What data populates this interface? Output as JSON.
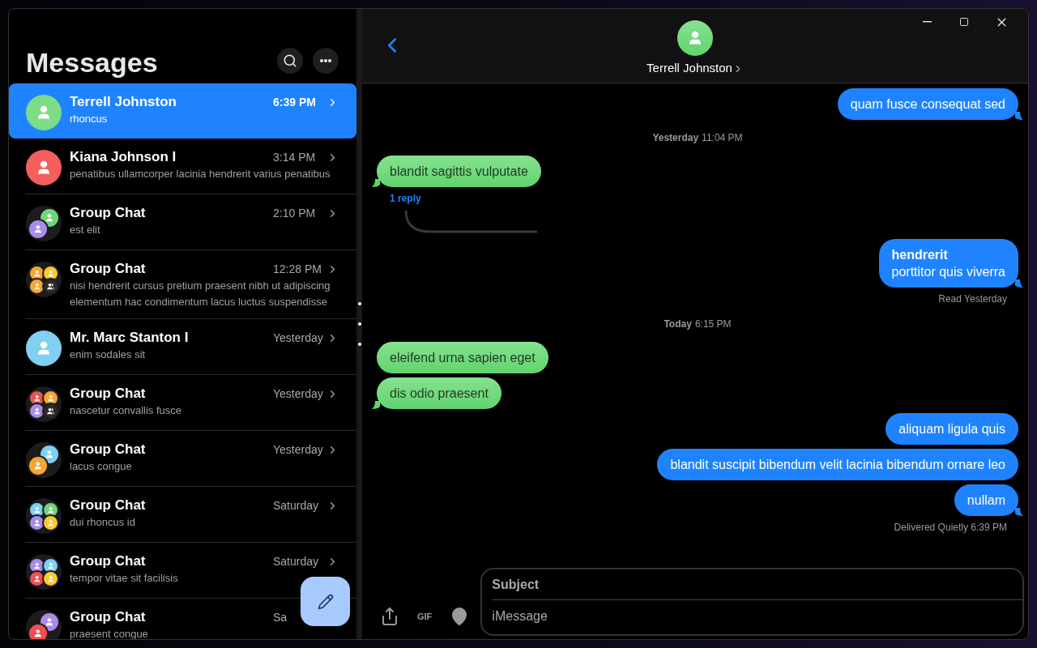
{
  "sidebar": {
    "title": "Messages",
    "conversations": [
      {
        "name": "Terrell Johnston",
        "time": "6:39 PM",
        "preview": "rhoncus",
        "selected": true,
        "avatar": [
          {
            "kind": "person",
            "color": "#7ddc86"
          }
        ]
      },
      {
        "name": "Kiana Johnson I",
        "time": "3:14 PM",
        "preview": "penatibus ullamcorper lacinia hendrerit varius penatibus",
        "selected": false,
        "avatar": [
          {
            "kind": "person",
            "color": "#f25f5c"
          }
        ]
      },
      {
        "name": "Group Chat",
        "time": "2:10 PM",
        "preview": "est elit",
        "selected": false,
        "avatar": [
          {
            "kind": "person",
            "color": "#6fd67a"
          },
          {
            "kind": "person",
            "color": "#a98be8"
          }
        ]
      },
      {
        "name": "Group Chat",
        "time": "12:28 PM",
        "preview": "nisi hendrerit cursus pretium praesent nibh ut adipiscing elementum hac condimentum lacus luctus suspendisse",
        "selected": false,
        "avatar": [
          {
            "kind": "person",
            "color": "#f8a532"
          },
          {
            "kind": "person",
            "color": "#f8c932"
          },
          {
            "kind": "person",
            "color": "#f8a532"
          },
          {
            "kind": "group",
            "color": "#2a2a2a"
          }
        ]
      },
      {
        "name": "Mr. Marc Stanton I",
        "time": "Yesterday",
        "preview": "enim sodales sit",
        "selected": false,
        "avatar": [
          {
            "kind": "person",
            "color": "#7fd0f2"
          }
        ]
      },
      {
        "name": "Group Chat",
        "time": "Yesterday",
        "preview": "nascetur convallis fusce",
        "selected": false,
        "avatar": [
          {
            "kind": "person",
            "color": "#f05050"
          },
          {
            "kind": "person",
            "color": "#f8a532"
          },
          {
            "kind": "person",
            "color": "#a98be8"
          },
          {
            "kind": "group",
            "color": "#2a2a2a"
          }
        ]
      },
      {
        "name": "Group Chat",
        "time": "Yesterday",
        "preview": "lacus congue",
        "selected": false,
        "avatar": [
          {
            "kind": "person",
            "color": "#7fd0f2"
          },
          {
            "kind": "person",
            "color": "#f8a532"
          }
        ]
      },
      {
        "name": "Group Chat",
        "time": "Saturday",
        "preview": "dui rhoncus id",
        "selected": false,
        "avatar": [
          {
            "kind": "person",
            "color": "#7fd0f2"
          },
          {
            "kind": "person",
            "color": "#6fd67a"
          },
          {
            "kind": "person",
            "color": "#a98be8"
          },
          {
            "kind": "person",
            "color": "#f8c932"
          }
        ]
      },
      {
        "name": "Group Chat",
        "time": "Saturday",
        "preview": "tempor vitae sit facilisis",
        "selected": false,
        "avatar": [
          {
            "kind": "person",
            "color": "#a98be8"
          },
          {
            "kind": "person",
            "color": "#7fd0f2"
          },
          {
            "kind": "person",
            "color": "#f05050"
          },
          {
            "kind": "person",
            "color": "#f8c932"
          }
        ]
      },
      {
        "name": "Group Chat",
        "time": "Sa",
        "preview": "praesent congue",
        "selected": false,
        "avatar": [
          {
            "kind": "person",
            "color": "#a98be8"
          },
          {
            "kind": "person",
            "color": "#f05050"
          }
        ]
      }
    ]
  },
  "chat": {
    "contact": "Terrell Johnston",
    "messages": [
      {
        "kind": "sent",
        "text": "quam fusce consequat sed",
        "tail": true
      },
      {
        "kind": "timestamp",
        "day": "Yesterday",
        "time": "11:04 PM"
      },
      {
        "kind": "received",
        "text": "blandit sagittis vulputate",
        "tail": true
      },
      {
        "kind": "reply_link",
        "text": "1 reply"
      },
      {
        "kind": "sent",
        "text": "**hendrerit**\nporttitor quis viverra",
        "tail": true
      },
      {
        "kind": "status",
        "text": "Read Yesterday"
      },
      {
        "kind": "timestamp",
        "day": "Today",
        "time": "6:15 PM"
      },
      {
        "kind": "received",
        "text": "eleifend urna sapien eget",
        "tail": false
      },
      {
        "kind": "received",
        "text": "dis odio praesent",
        "tail": true
      },
      {
        "kind": "sent",
        "text": "aliquam ligula quis",
        "tail": false
      },
      {
        "kind": "sent",
        "text": "blandit suscipit bibendum velit lacinia bibendum ornare leo",
        "tail": false
      },
      {
        "kind": "sent",
        "text": "nullam",
        "tail": true
      },
      {
        "kind": "status",
        "text": "Delivered Quietly 6:39 PM"
      }
    ],
    "composer": {
      "gif": "GIF",
      "subject_placeholder": "Subject",
      "message_placeholder": "iMessage"
    }
  }
}
